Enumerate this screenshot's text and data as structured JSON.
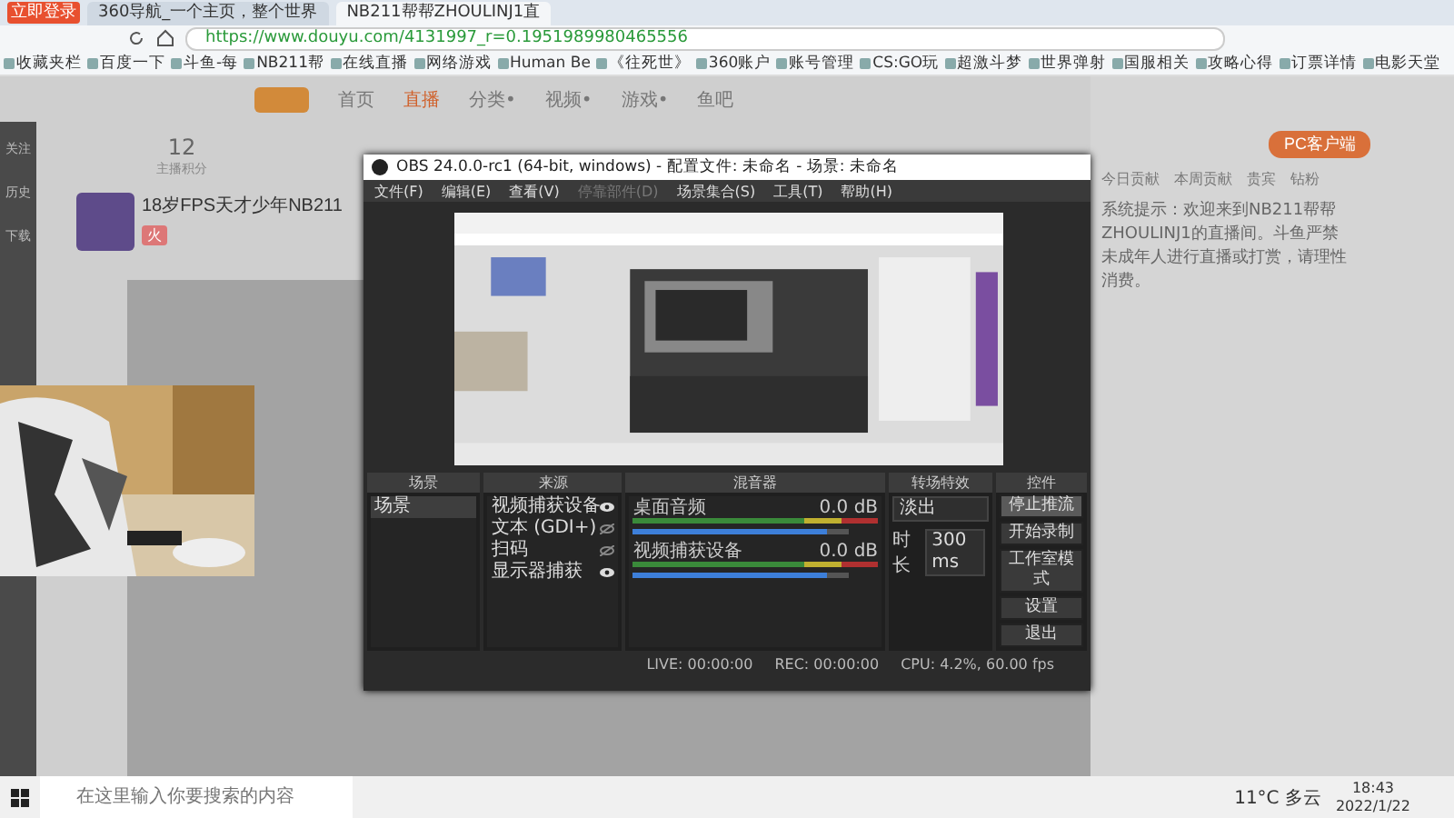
{
  "browser": {
    "login_badge": "立即登录",
    "tabs": [
      {
        "label": "360导航_一个主页，整个世界",
        "selected": false
      },
      {
        "label": "NB211帮帮ZHOULINJ1直",
        "selected": true
      }
    ],
    "url": "https://www.douyu.com/4131997_r=0.1951989980465556",
    "bookmarks": [
      "收藏夹栏",
      "百度一下",
      "斗鱼-每",
      "NB211帮",
      "在线直播",
      "网络游戏",
      "Human Be",
      "《往死世》",
      "360账户",
      "账号管理",
      "CS:GO玩",
      "超激斗梦",
      "世界弹射",
      "国服相关",
      "攻略心得",
      "订票详情",
      "电影天堂"
    ]
  },
  "site": {
    "nav": [
      {
        "label": "首页",
        "selected": false
      },
      {
        "label": "直播",
        "selected": true
      },
      {
        "label": "分类•",
        "selected": false
      },
      {
        "label": "视频•",
        "selected": false
      },
      {
        "label": "游戏•",
        "selected": false
      },
      {
        "label": "鱼吧",
        "selected": false
      }
    ],
    "rail": [
      "关注",
      "历史",
      "下载"
    ],
    "stat_count": "12",
    "stat_label": "主播积分",
    "room_title": "18岁FPS天才少年NB211",
    "tag": "火",
    "client_button": "PC客户端",
    "rank_tabs": [
      "今日贡献",
      "本周贡献",
      "贵宾",
      "钻粉"
    ],
    "chat": "系统提示：欢迎来到NB211帮帮ZHOULINJ1的直播间。斗鱼严禁未成年人进行直播或打赏，请理性消费。"
  },
  "obs": {
    "title": "OBS 24.0.0-rc1 (64-bit, windows) - 配置文件: 未命名 - 场景: 未命名",
    "menu": [
      {
        "label": "文件(F)",
        "disabled": false
      },
      {
        "label": "编辑(E)",
        "disabled": false
      },
      {
        "label": "查看(V)",
        "disabled": false
      },
      {
        "label": "停靠部件(D)",
        "disabled": true
      },
      {
        "label": "场景集合(S)",
        "disabled": false
      },
      {
        "label": "工具(T)",
        "disabled": false
      },
      {
        "label": "帮助(H)",
        "disabled": false
      }
    ],
    "docks": {
      "scenes_title": "场景",
      "sources_title": "来源",
      "mixer_title": "混音器",
      "transitions_title": "转场特效",
      "controls_title": "控件"
    },
    "scenes": [
      {
        "label": "场景",
        "selected": true
      }
    ],
    "sources": [
      {
        "label": "视频捕获设备",
        "visible": true
      },
      {
        "label": "文本 (GDI+)",
        "visible": false
      },
      {
        "label": "扫码",
        "visible": false
      },
      {
        "label": "显示器捕获",
        "visible": true
      }
    ],
    "mixer": [
      {
        "name": "桌面音频",
        "reading": "0.0 dB",
        "level": 0.9
      },
      {
        "name": "视频捕获设备",
        "reading": "0.0 dB",
        "level": 0.9
      }
    ],
    "transition": {
      "value": "淡出",
      "duration_label": "时长",
      "duration": "300 ms"
    },
    "controls": [
      {
        "label": "停止推流",
        "selected": true
      },
      {
        "label": "开始录制",
        "selected": false
      },
      {
        "label": "工作室模式",
        "selected": false
      },
      {
        "label": "设置",
        "selected": false
      },
      {
        "label": "退出",
        "selected": false
      }
    ],
    "status": [
      "LIVE: 00:00:00",
      "REC: 00:00:00",
      "CPU: 4.2%, 60.00 fps"
    ]
  },
  "taskbar": {
    "search_placeholder": "在这里输入你要搜索的内容",
    "weather": "11°C 多云",
    "time": "18:43",
    "date": "2022/1/22"
  }
}
